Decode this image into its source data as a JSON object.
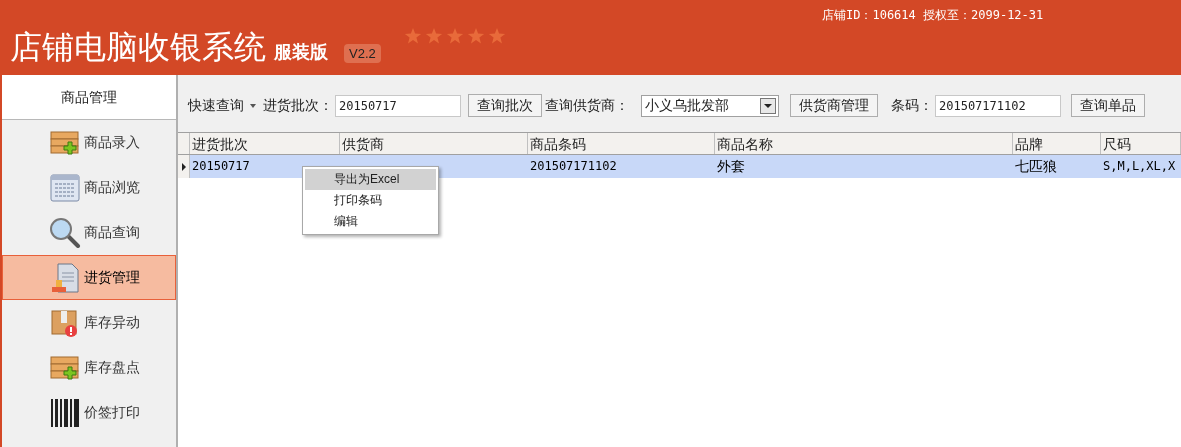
{
  "header": {
    "title": "店铺电脑收银系统",
    "edition": "服装版",
    "version": "V2.2",
    "store_info": "店铺ID：106614 授权至：2099-12-31"
  },
  "sidebar": {
    "title": "商品管理",
    "items": [
      {
        "label": "商品录入",
        "kind": "add",
        "selected": false
      },
      {
        "label": "商品浏览",
        "kind": "list",
        "selected": false
      },
      {
        "label": "商品查询",
        "kind": "search",
        "selected": false
      },
      {
        "label": "进货管理",
        "kind": "document",
        "selected": true
      },
      {
        "label": "库存异动",
        "kind": "box",
        "selected": false
      },
      {
        "label": "库存盘点",
        "kind": "add",
        "selected": false
      },
      {
        "label": "价签打印",
        "kind": "barcode",
        "selected": false
      }
    ]
  },
  "toolbar": {
    "quick_query": "快速查询",
    "batch_label": "进货批次：",
    "batch_value": "20150717",
    "batch_button": "查询批次",
    "supplier_label": "查询供货商：",
    "supplier_value": "小义乌批发部",
    "supplier_button": "供货商管理",
    "barcode_label": "条码：",
    "barcode_value": "201507171102",
    "barcode_button": "查询单品"
  },
  "table": {
    "columns": [
      "进货批次",
      "供货商",
      "商品条码",
      "商品名称",
      "品牌",
      "尺码"
    ],
    "rows": [
      {
        "selected": true,
        "cells": [
          "20150717",
          null,
          "201507171102",
          "外套",
          "七匹狼",
          "S,M,L,XL,X"
        ]
      }
    ]
  },
  "context_menu": {
    "items": [
      {
        "label": "导出为Excel",
        "selected": true
      },
      {
        "label": "打印条码",
        "selected": false
      },
      {
        "label": "编辑",
        "selected": false
      }
    ]
  }
}
